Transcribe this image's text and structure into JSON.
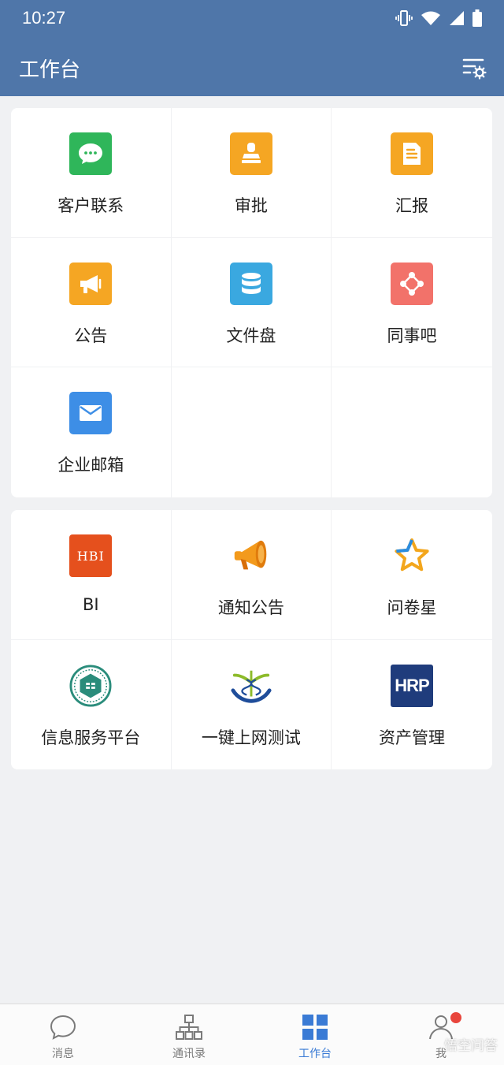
{
  "status": {
    "time": "10:27"
  },
  "header": {
    "title": "工作台"
  },
  "apps_section_1": [
    {
      "label": "客户联系",
      "icon": "chat-bubble-icon",
      "color": "#2fb65a"
    },
    {
      "label": "审批",
      "icon": "stamp-icon",
      "color": "#f5a623"
    },
    {
      "label": "汇报",
      "icon": "report-doc-icon",
      "color": "#f5a623"
    },
    {
      "label": "公告",
      "icon": "megaphone-icon",
      "color": "#f5a623"
    },
    {
      "label": "文件盘",
      "icon": "database-icon",
      "color": "#3aa8e0"
    },
    {
      "label": "同事吧",
      "icon": "network-icon",
      "color": "#f2726a"
    },
    {
      "label": "企业邮箱",
      "icon": "mail-icon",
      "color": "#3d8ee6"
    }
  ],
  "apps_section_2": [
    {
      "label": "BI",
      "icon": "hbi-logo-icon",
      "logo_text": "HBI",
      "color": "#e5501d"
    },
    {
      "label": "通知公告",
      "icon": "orange-megaphone-icon",
      "color": "#f39a1c"
    },
    {
      "label": "问卷星",
      "icon": "star-icon",
      "color": "#f3a61c"
    },
    {
      "label": "信息服务平台",
      "icon": "seal-emblem-icon",
      "color": "#2a8c7b"
    },
    {
      "label": "一键上网测试",
      "icon": "caduceus-emblem-icon",
      "color": "#1f4d9a"
    },
    {
      "label": "资产管理",
      "icon": "hrp-logo-icon",
      "logo_text": "HRP",
      "color": "#1f3c7c"
    }
  ],
  "tabbar": [
    {
      "label": "消息",
      "icon": "message-bubble-icon",
      "active": false
    },
    {
      "label": "通讯录",
      "icon": "org-chart-icon",
      "active": false
    },
    {
      "label": "工作台",
      "icon": "grid-icon",
      "active": true
    },
    {
      "label": "我",
      "icon": "person-icon",
      "active": false
    }
  ],
  "watermark": "悟空问答"
}
